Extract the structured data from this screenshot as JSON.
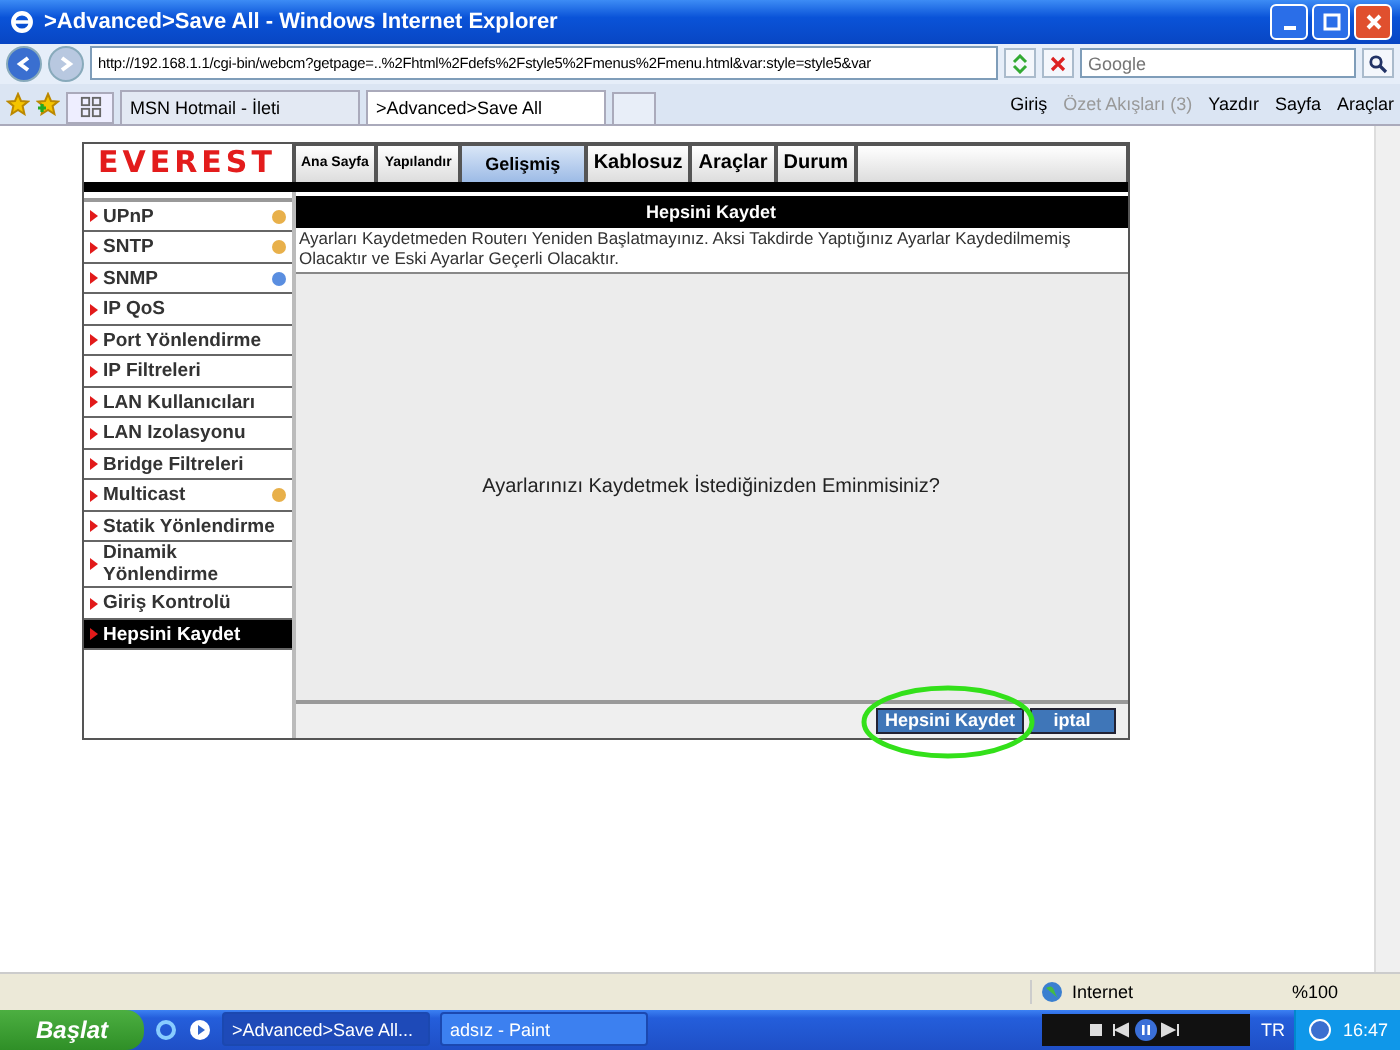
{
  "window": {
    "title": ">Advanced>Save All - Windows Internet Explorer"
  },
  "address": {
    "url": "http://192.168.1.1/cgi-bin/webcm?getpage=..%2Fhtml%2Fdefs%2Fstyle5%2Fmenus%2Fmenu.html&var:style=style5&var"
  },
  "search": {
    "placeholder": "Google"
  },
  "browser_tabs": [
    {
      "label": "MSN Hotmail - İleti",
      "selected": false
    },
    {
      "label": ">Advanced>Save All",
      "selected": true
    }
  ],
  "command_bar": [
    {
      "label": "Giriş",
      "disabled": false
    },
    {
      "label": "Özet Akışları (3)",
      "disabled": true
    },
    {
      "label": "Yazdır",
      "disabled": false
    },
    {
      "label": "Sayfa",
      "disabled": false
    },
    {
      "label": "Araçlar",
      "disabled": false
    }
  ],
  "router": {
    "logo": "EVEREST",
    "nav_tabs": [
      {
        "label": "Ana Sayfa",
        "selected": false
      },
      {
        "label": "Yapılandır",
        "selected": false
      },
      {
        "label": "Gelişmiş",
        "selected": true
      },
      {
        "label": "Kablosuz",
        "selected": false
      },
      {
        "label": "Araçlar",
        "selected": false
      },
      {
        "label": "Durum",
        "selected": false
      }
    ],
    "sidebar": [
      {
        "label": "UPnP",
        "selected": false,
        "color": "#e8b04a"
      },
      {
        "label": "SNTP",
        "selected": false,
        "color": "#e8b04a"
      },
      {
        "label": "SNMP",
        "selected": false,
        "color": "#5a8ee0"
      },
      {
        "label": "IP QoS",
        "selected": false
      },
      {
        "label": "Port Yönlendirme",
        "selected": false
      },
      {
        "label": "IP Filtreleri",
        "selected": false
      },
      {
        "label": "LAN Kullanıcıları",
        "selected": false
      },
      {
        "label": "LAN Izolasyonu",
        "selected": false
      },
      {
        "label": "Bridge Filtreleri",
        "selected": false
      },
      {
        "label": "Multicast",
        "selected": false,
        "color": "#e8b04a"
      },
      {
        "label": "Statik Yönlendirme",
        "selected": false
      },
      {
        "label": "Dinamik Yönlendirme",
        "selected": false
      },
      {
        "label": "Giriş Kontrolü",
        "selected": false
      },
      {
        "label": "Hepsini Kaydet",
        "selected": true
      }
    ],
    "panel_title": "Hepsini Kaydet",
    "warning": "Ayarları Kaydetmeden Routerı Yeniden Başlatmayınız. Aksi Takdirde Yaptığınız Ayarlar Kaydedilmemiş Olacaktır ve Eski Ayarlar Geçerli Olacaktır.",
    "question": "Ayarlarınızı Kaydetmek İstediğinizden Eminmisiniz?",
    "buttons": [
      "Hepsini Kaydet",
      "iptal"
    ]
  },
  "status_bar": {
    "zone": "Internet",
    "zoom": "%100"
  },
  "taskbar": {
    "start": "Başlat",
    "tasks": [
      {
        "label": ">Advanced>Save All...",
        "selected": true
      },
      {
        "label": "adsız - Paint",
        "selected": false
      }
    ],
    "language": "TR",
    "clock": "16:47"
  }
}
